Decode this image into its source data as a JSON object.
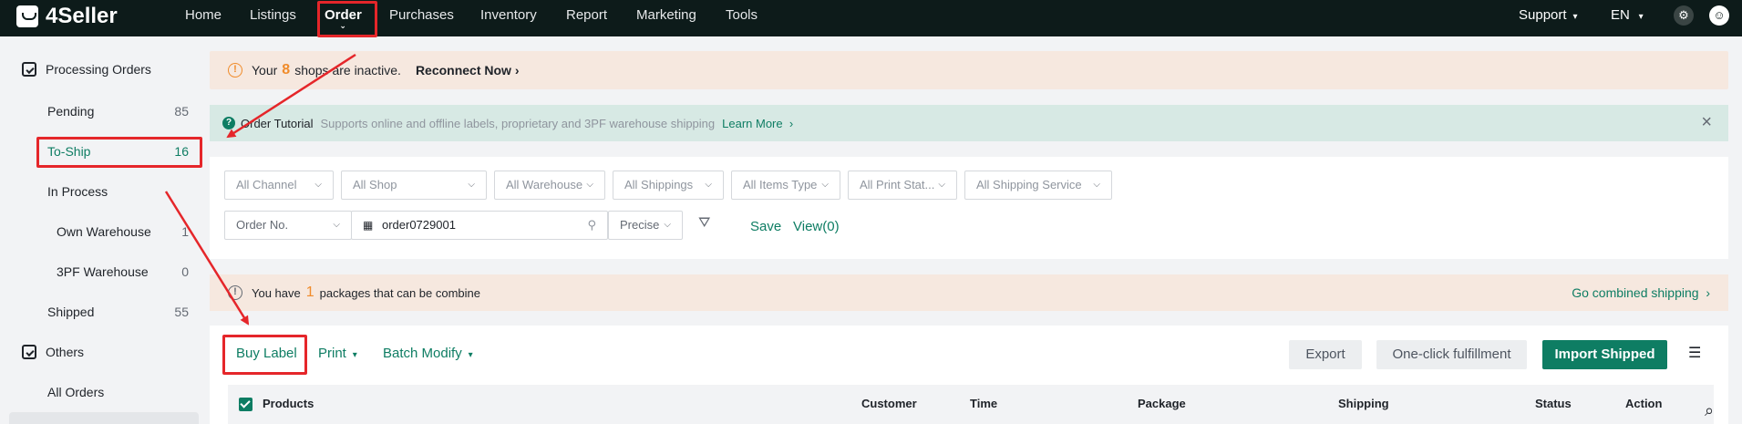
{
  "brand": {
    "name": "4Seller"
  },
  "nav": {
    "items": [
      "Home",
      "Listings",
      "Order",
      "Purchases",
      "Inventory",
      "Report",
      "Marketing",
      "Tools"
    ],
    "right": {
      "support": "Support",
      "lang": "EN"
    }
  },
  "sidebar": {
    "group1": "Processing Orders",
    "items": [
      {
        "label": "Pending",
        "count": "85"
      },
      {
        "label": "To-Ship",
        "count": "16"
      },
      {
        "label": "In Process",
        "count": ""
      },
      {
        "label": "Own Warehouse",
        "count": "1"
      },
      {
        "label": "3PF Warehouse",
        "count": "0"
      },
      {
        "label": "Shipped",
        "count": "55"
      }
    ],
    "group2": "Others",
    "all_orders": "All Orders"
  },
  "warning": {
    "pre": "Your",
    "count": "8",
    "post": "shops are inactive.",
    "action": "Reconnect Now"
  },
  "tutorial": {
    "title": "Order Tutorial",
    "desc": "Supports online and offline labels, proprietary and 3PF warehouse shipping",
    "link": "Learn More"
  },
  "filters": {
    "row1": [
      "All Channel",
      "All Shop",
      "All Warehouse",
      "All Shippings",
      "All Items Type",
      "All Print Stat...",
      "All Shipping Service"
    ],
    "search_type": "Order No.",
    "search_value": "order0729001",
    "match": "Precise",
    "save": "Save",
    "view": "View(0)"
  },
  "combine": {
    "pre": "You have",
    "count": "1",
    "post": "packages that can be combine",
    "link": "Go combined shipping"
  },
  "toolbar": {
    "buy_label": "Buy Label",
    "print": "Print",
    "batch_modify": "Batch Modify",
    "export": "Export",
    "one_click": "One-click fulfillment",
    "import": "Import Shipped"
  },
  "table": {
    "columns": [
      "Products",
      "Customer",
      "Time",
      "Package",
      "Shipping",
      "Status",
      "Action"
    ]
  },
  "colors": {
    "accent": "#0e7d63",
    "nav_bg": "#0d1b1a",
    "highlight": "#e5262a",
    "warn": "#f08b2a"
  }
}
